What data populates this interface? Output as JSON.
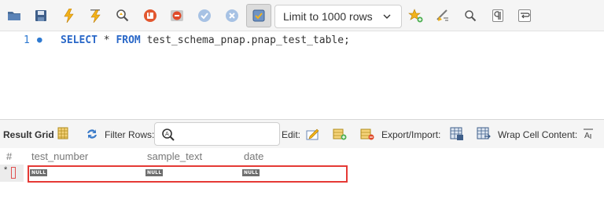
{
  "toolbar": {
    "icons": [
      "open-folder-icon",
      "save-icon",
      "execute-icon",
      "execute-current-icon",
      "explain-icon",
      "stop-icon",
      "toggle-error-icon",
      "commit-icon",
      "rollback-icon",
      "autocommit-icon",
      "bookmark-icon",
      "beautify-icon",
      "find-icon",
      "invisible-chars-icon",
      "wrap-lines-icon"
    ],
    "limit_label": "Limit to 1000 rows"
  },
  "editor": {
    "line_number": "1",
    "bullet": "●",
    "kw_select": "SELECT",
    "star": " * ",
    "kw_from": "FROM",
    "table": " test_schema_pnap.pnap_test_table;"
  },
  "results": {
    "result_grid_label": "Result Grid",
    "filter_rows_label": "Filter Rows:",
    "edit_label": "Edit:",
    "export_import_label": "Export/Import:",
    "wrap_label": "Wrap Cell Content:",
    "columns": [
      "#",
      "test_number",
      "sample_text",
      "date"
    ],
    "new_row_marker": "*",
    "null_label": "NULL"
  },
  "colors": {
    "keyword": "#2a68c8",
    "highlight": "#e53935",
    "null_badge": "#6e6e6e"
  }
}
